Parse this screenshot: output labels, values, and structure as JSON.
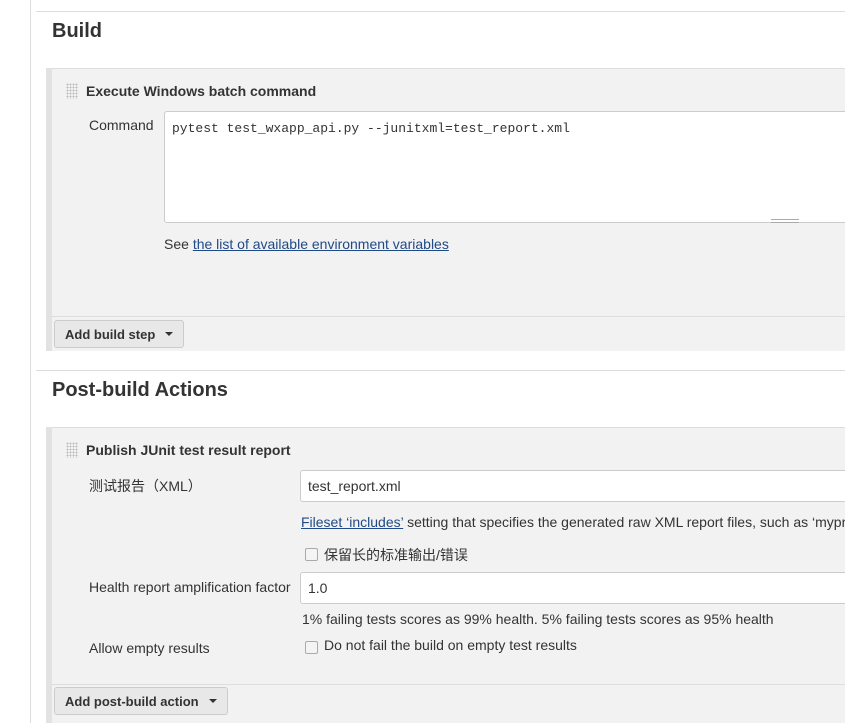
{
  "build": {
    "heading": "Build",
    "step_title": "Execute Windows batch command",
    "command_label": "Command",
    "command_value": "pytest test_wxapp_api.py --junitxml=test_report.xml",
    "see_text": "See ",
    "env_link": "the list of available environment variables",
    "add_button": "Add build step"
  },
  "post": {
    "heading": "Post-build Actions",
    "step_title": "Publish JUnit test result report",
    "xml_label": "测试报告（XML）",
    "xml_value": "test_report.xml",
    "fileset_link": "Fileset ‘includes’",
    "fileset_text": " setting that specifies the generated raw XML report files, such as ‘mypr",
    "retain_label": "保留长的标准输出/错误",
    "health_label": "Health report amplification factor",
    "health_value": "1.0",
    "health_help": "1% failing tests scores as 99% health. 5% failing tests scores as 95% health",
    "empty_label": "Allow empty results",
    "empty_checkbox": "Do not fail the build on empty test results",
    "add_button": "Add post-build action"
  }
}
